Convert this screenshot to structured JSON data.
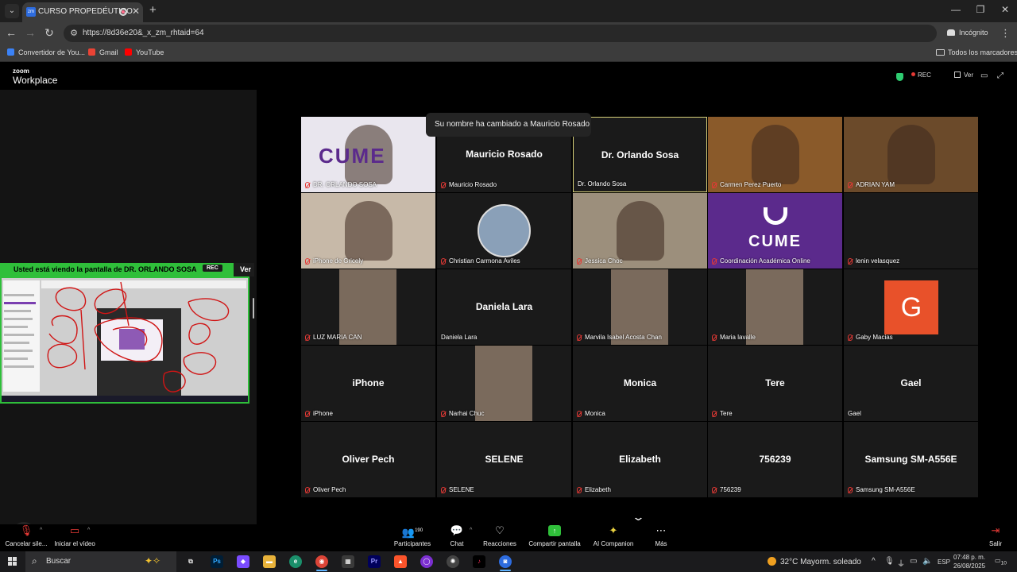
{
  "browser": {
    "tab_title": "CURSO PROPEDÉUTICO",
    "url": "https://8d36e20&_x_zm_rhtaid=64",
    "incognito_label": "Incógnito",
    "bookmarks": [
      {
        "label": "Convertidor de You...",
        "color": "#3b82f6"
      },
      {
        "label": "Gmail",
        "color": "#ea4335"
      },
      {
        "label": "YouTube",
        "color": "#ff0000"
      }
    ],
    "all_bookmarks_label": "Todos los marcadores"
  },
  "zoom": {
    "brand_small": "zoom",
    "brand_large": "Workplace",
    "rec_label": "REC",
    "view_label": "Ver",
    "share_banner": "Usted está viendo la pantalla de  DR. ORLANDO SOSA",
    "share_rec": "REC",
    "share_ver": "Ver",
    "toast": "Su nombre ha cambiado a Mauricio Rosado",
    "tiles": [
      {
        "label": "DR. ORLANDO SOSA",
        "big": "",
        "kind": "video",
        "bg": "#e9e6ee",
        "muted": true
      },
      {
        "label": "Mauricio Rosado",
        "big": "Mauricio Rosado",
        "kind": "name",
        "bg": "#1a1a1a",
        "muted": true
      },
      {
        "label": "Dr. Orlando Sosa",
        "big": "Dr. Orlando Sosa",
        "kind": "name",
        "bg": "#1a1a1a",
        "muted": false,
        "active": true
      },
      {
        "label": "Carmen Perez Puerto",
        "big": "",
        "kind": "video",
        "bg": "#8a5a2a",
        "muted": true
      },
      {
        "label": "ADRIAN YAM",
        "big": "",
        "kind": "video",
        "bg": "#6b4a2a",
        "muted": true
      },
      {
        "label": "iPhone de Gricely",
        "big": "",
        "kind": "video",
        "bg": "#c7b9a8",
        "muted": true
      },
      {
        "label": "Christian Carmona Aviles",
        "big": "",
        "kind": "avatar",
        "bg": "#1a1a1a",
        "muted": true
      },
      {
        "label": "Jessica Choc",
        "big": "",
        "kind": "video",
        "bg": "#9c8f7c",
        "muted": true
      },
      {
        "label": "Coordinación Académica Online",
        "big": "",
        "kind": "logo",
        "bg": "#5b2a8c",
        "muted": true
      },
      {
        "label": "lenin velasquez",
        "big": "",
        "kind": "name",
        "bg": "#1a1a1a",
        "muted": true
      },
      {
        "label": "LUZ MARIA CAN",
        "big": "",
        "kind": "phone",
        "bg": "#1a1a1a",
        "muted": true
      },
      {
        "label": "Daniela Lara",
        "big": "Daniela Lara",
        "kind": "name",
        "bg": "#1a1a1a",
        "muted": false
      },
      {
        "label": "Marvila Isabel Acosta Chan",
        "big": "",
        "kind": "phone",
        "bg": "#1a1a1a",
        "muted": true
      },
      {
        "label": "Maria lavalle",
        "big": "",
        "kind": "phone",
        "bg": "#1a1a1a",
        "muted": true
      },
      {
        "label": "Gaby Macias",
        "big": "",
        "kind": "letter",
        "letter": "G",
        "bg": "#1a1a1a",
        "muted": true
      },
      {
        "label": "iPhone",
        "big": "iPhone",
        "kind": "name",
        "bg": "#1a1a1a",
        "muted": true
      },
      {
        "label": "Narhai Chuc",
        "big": "",
        "kind": "phone",
        "bg": "#1a1a1a",
        "muted": true
      },
      {
        "label": "Monica",
        "big": "Monica",
        "kind": "name",
        "bg": "#1a1a1a",
        "muted": true
      },
      {
        "label": "Tere",
        "big": "Tere",
        "kind": "name",
        "bg": "#1a1a1a",
        "muted": true
      },
      {
        "label": "Gael",
        "big": "Gael",
        "kind": "name",
        "bg": "#1a1a1a",
        "muted": false
      },
      {
        "label": "Oliver Pech",
        "big": "Oliver Pech",
        "kind": "name",
        "bg": "#1a1a1a",
        "muted": true
      },
      {
        "label": "SELENE",
        "big": "SELENE",
        "kind": "name",
        "bg": "#1a1a1a",
        "muted": true
      },
      {
        "label": "Elizabeth",
        "big": "Elizabeth",
        "kind": "name",
        "bg": "#1a1a1a",
        "muted": true
      },
      {
        "label": "756239",
        "big": "756239",
        "kind": "name",
        "bg": "#1a1a1a",
        "muted": true
      },
      {
        "label": "Samsung SM-A556E",
        "big": "Samsung SM-A556E",
        "kind": "name",
        "bg": "#1a1a1a",
        "muted": true
      }
    ],
    "logo_text": "CUME",
    "controls": {
      "mute": "Cancelar sile...",
      "video": "Iniciar el vídeo",
      "participants": "Participantes",
      "participants_count": "190",
      "chat": "Chat",
      "reactions": "Reacciones",
      "share": "Compartir pantalla",
      "ai": "AI Companion",
      "more": "Más",
      "leave": "Salir"
    }
  },
  "taskbar": {
    "search": "Buscar",
    "weather": "32°C  Mayorm. soleado",
    "lang": "ESP",
    "time": "07:48 p. m.",
    "date": "26/08/2025",
    "notif": "10"
  },
  "colors": {
    "accent": "#2fbf3a",
    "mute_red": "#e53935",
    "cume_purple": "#5b2a8c",
    "gaby_orange": "#e8512a"
  }
}
